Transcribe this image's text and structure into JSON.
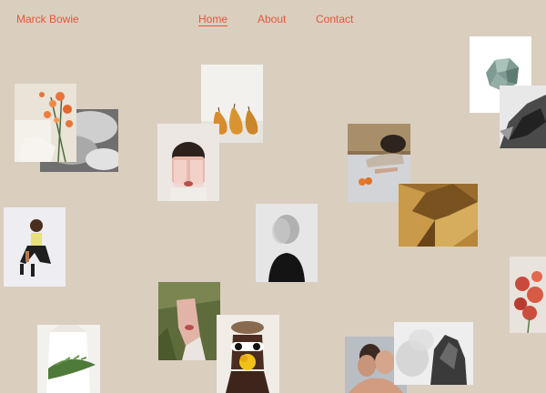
{
  "site": {
    "brand": "Marck Bowie",
    "accent_color": "#e8573a",
    "background_color": "#dacebf"
  },
  "nav": {
    "items": [
      {
        "label": "Home",
        "active": true
      },
      {
        "label": "About",
        "active": false
      },
      {
        "label": "Contact",
        "active": false
      }
    ]
  },
  "gallery": {
    "images": [
      "orange-flowers-photo",
      "clouds-photo",
      "pears-photo",
      "face-glasses-photo",
      "woman-lying-table-photo",
      "gold-foil-photo",
      "mineral-stone-photo",
      "dark-abstract-photo",
      "woman-sitting-photo",
      "blurred-portrait-photo",
      "red-flowers-photo",
      "face-in-grass-photo",
      "yellow-flower-sunglasses-photo",
      "white-coat-fern-photo",
      "couple-portrait-photo",
      "rock-smoke-photo"
    ]
  }
}
